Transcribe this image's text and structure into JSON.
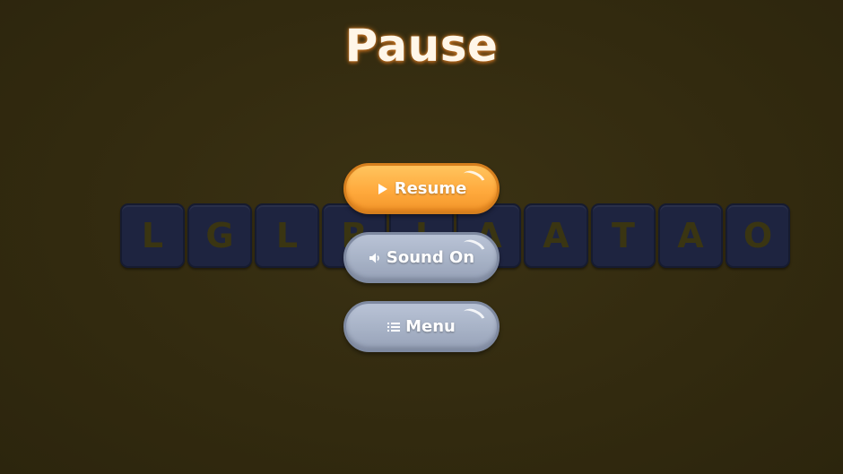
{
  "title": "Pause",
  "tiles": [
    "L",
    "G",
    "L",
    "R",
    "I",
    "A",
    "A",
    "T",
    "A",
    "O"
  ],
  "buttons": {
    "resume": {
      "label": "Resume",
      "icon": "play-icon"
    },
    "sound": {
      "label": "Sound On",
      "icon": "speaker-icon"
    },
    "menu": {
      "label": "Menu",
      "icon": "list-icon"
    }
  },
  "colors": {
    "background": "#342b10",
    "resume_button": "#ffaa3d",
    "secondary_button": "#a7b2c6",
    "tile": "#1e2440",
    "title_glow": "#c97a28"
  }
}
